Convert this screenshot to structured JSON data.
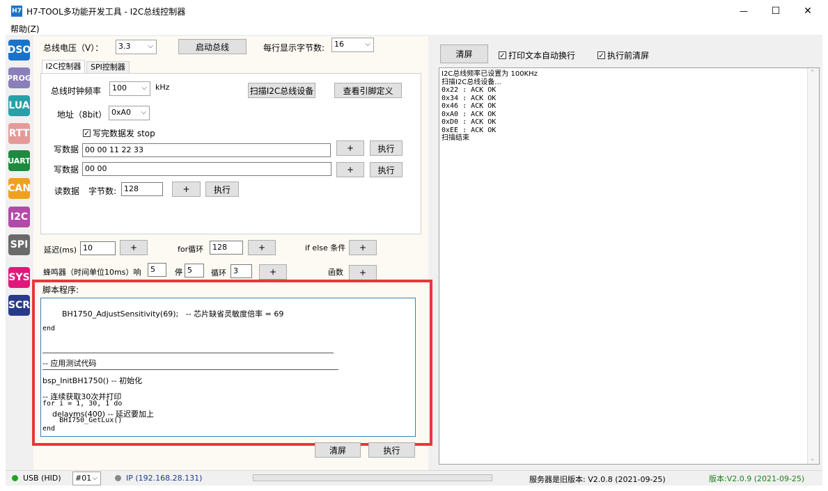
{
  "window": {
    "logo": "H7",
    "title": "H7-TOOL多功能开发工具 - I2C总线控制器",
    "menu_help": "帮助(Z)",
    "minimize": "—",
    "maximize": "☐",
    "close": "✕"
  },
  "sidebar": [
    "DSO",
    "PROG",
    "LUA",
    "RTT",
    "UART",
    "CAN",
    "I2C",
    "SPI",
    "SYS",
    "SCR"
  ],
  "sidebar_colors": [
    "#1a73c8",
    "#8a7fb8",
    "#27a0a8",
    "#e59a9a",
    "#1e8a3f",
    "#f0a020",
    "#b24aa8",
    "#6a6a6a",
    "#e0187a",
    "#2a3a8a"
  ],
  "top": {
    "voltage_label": "总线电压（V）：",
    "voltage_value": "3.3",
    "start_bus": "启动总线",
    "bytes_per_line_label": "每行显示字节数:",
    "bytes_per_line_value": "16"
  },
  "tabs": {
    "i2c": "I2C控制器",
    "spi": "SPI控制器"
  },
  "i2c": {
    "clock_label": "总线时钟频率",
    "clock_value": "100",
    "clock_unit": "kHz",
    "scan_button": "扫描I2C总线设备",
    "pin_button": "查看引脚定义",
    "addr_label": "地址（8bit）",
    "addr_value": "0xA0",
    "stop_label": "写完数据发 stop",
    "write1_label": "写数据",
    "write1_value": "00 00 11 22 33",
    "write2_label": "写数据",
    "write2_value": "00 00",
    "read_label": "读数据",
    "bytes_label": "字节数:",
    "bytes_value": "128",
    "plus": "+",
    "exec": "执行"
  },
  "controls": {
    "delay_label": "延迟(ms)",
    "delay_value": "10",
    "for_label": "for循环",
    "for_value": "128",
    "ifelse_label": "if else 条件",
    "beep_label": "蜂鸣器（时间单位10ms）响",
    "beep_on": "5",
    "beep_off_label": "停",
    "beep_off": "5",
    "loop_label": "循环",
    "loop_value": "3",
    "func_label": "函数",
    "plus": "+"
  },
  "script": {
    "title": "脚本程序:",
    "lines": [
      "        BH1750_AdjustSensitivity(69);   -- 芯片缺省灵敏度倍率 = 69",
      "end",
      "---------------------------------------------------------------------",
      "-- 应用测试代码",
      "---------------------------------------------------------------------",
      "bsp_InitBH1750() -- 初始化",
      "-- 连续获取30次并打印",
      "for i = 1, 30, 1 do",
      "    delayms(400) -- 延迟要加上",
      "    BH1750_GetLux()",
      "end"
    ],
    "clear": "清屏",
    "exec": "执行"
  },
  "right": {
    "clear": "清屏",
    "auto_wrap": "打印文本自动换行",
    "clear_before": "执行前清屏",
    "output": [
      "I2C总线频率已设置为 100KHz",
      "扫描I2C总线设备...",
      "0x22 : ACK OK",
      "0x34 : ACK OK",
      "0x46 : ACK OK",
      "0xA0 : ACK OK",
      "0xD0 : ACK OK",
      "0xEE : ACK OK",
      "扫描结束"
    ]
  },
  "status": {
    "usb": "USB (HID)",
    "device": "#01",
    "ip": "IP (192.168.28.131)",
    "server": "服务器是旧版本: V2.0.8 (2021-09-25)",
    "version": "版本:V2.0.9 (2021-09-25)"
  },
  "colors": {
    "accent_red": "#e8363c",
    "panel": "#fdfaf3",
    "status_green": "#21a321",
    "version_green": "#1a7f1a"
  }
}
